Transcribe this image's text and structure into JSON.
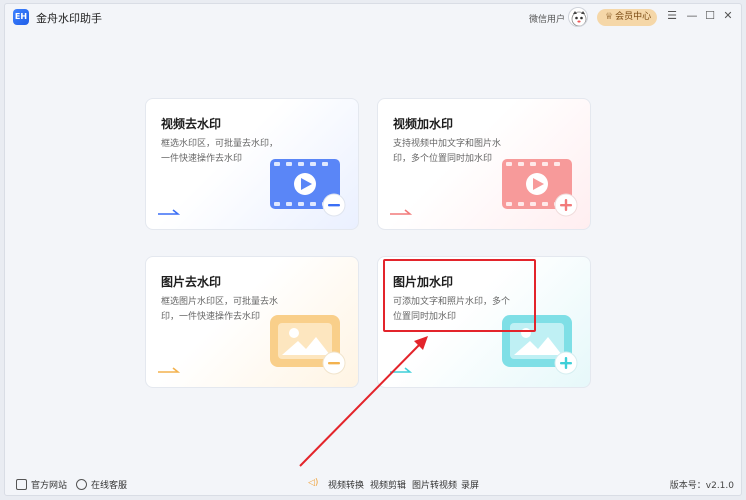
{
  "app": {
    "title": "金舟水印助手",
    "logo_text": "EH"
  },
  "header": {
    "user_label": "微信用户",
    "vip_label": "会员中心"
  },
  "window_controls": {
    "menu": "☰",
    "minimize": "—",
    "maximize": "☐",
    "close": "✕"
  },
  "cards": [
    {
      "title": "视频去水印",
      "desc": "框选水印区，可批量去水印，一件快速操作去水印",
      "accent": "#3b6ff5",
      "badge": "−"
    },
    {
      "title": "视频加水印",
      "desc": "支持视频中加文字和图片水印，多个位置同时加水印",
      "accent": "#f27a7a",
      "badge": "+"
    },
    {
      "title": "图片去水印",
      "desc": "框选图片水印区，可批量去水印，一件快速操作去水印",
      "accent": "#f3b24e",
      "badge": "−"
    },
    {
      "title": "图片加水印",
      "desc": "可添加文字和照片水印，多个位置同时加水印",
      "accent": "#3fcfd8",
      "badge": "+"
    }
  ],
  "footer": {
    "website": "官方网站",
    "support": "在线客服",
    "links": [
      "视频转换",
      "视频剪辑",
      "图片转视频",
      "录屏"
    ],
    "version": "版本号：v2.1.0"
  },
  "colors": {
    "highlight": "#e3242b"
  }
}
